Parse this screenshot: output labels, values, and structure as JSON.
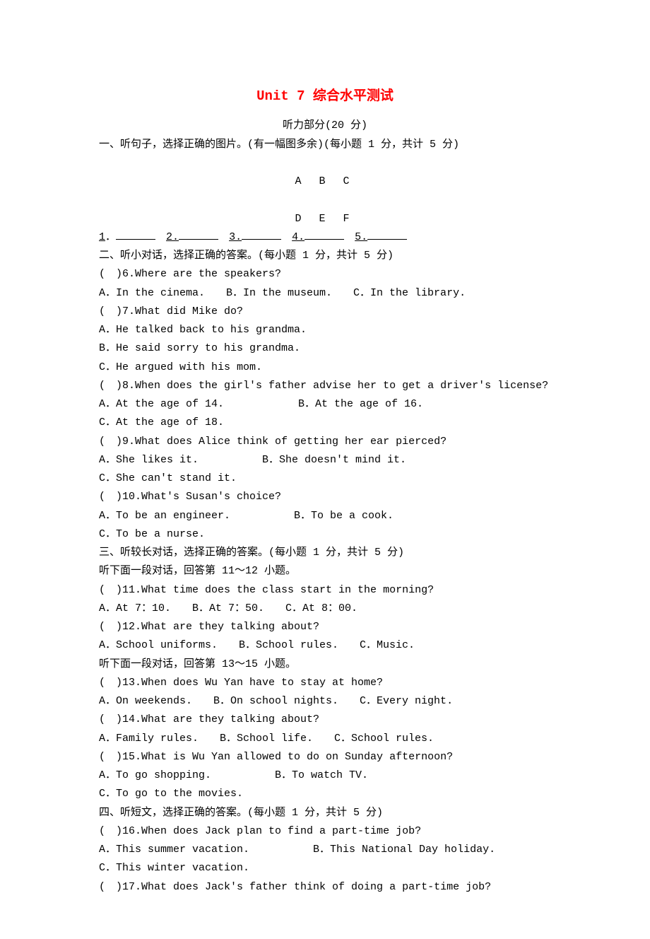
{
  "title": "Unit 7  综合水平测试",
  "subtitle": "听力部分(20 分)",
  "section1": {
    "heading": "一、听句子，选择正确的图片。(有一幅图多余)(每小题 1 分，共计 5 分)",
    "row1": "A   B   C",
    "row2": "D   E   F",
    "blanks": "1．________　2.________　3.________　4.________　5.________"
  },
  "section2": {
    "heading": "二、听小对话，选择正确的答案。(每小题 1 分，共计 5 分)",
    "q6": "(　)6.Where are the speakers?",
    "q6opts": "A．In the cinema.　　B．In the museum.　　C．In the library.",
    "q7": "(　)7.What did Mike do?",
    "q7a": "A．He talked back to his grandma.",
    "q7b": "B．He said sorry to his grandma.",
    "q7c": "C．He argued with his mom.",
    "q8": "(　)8.When does the girl's father advise her to get a driver's license?",
    "q8a": "A．At the age of 14.　　　　　　　B．At the age of 16.",
    "q8c": "C．At the age of 18.",
    "q9": "(　)9.What does Alice think of getting her ear pierced?",
    "q9a": "A．She likes it.　　　　　　B．She doesn't mind it.",
    "q9c": "C．She can't stand it.",
    "q10": "(　)10.What's Susan's choice?",
    "q10a": "A．To be an engineer.　　　　　　B．To be a cook.",
    "q10c": "C．To be a nurse."
  },
  "section3": {
    "heading": "三、听较长对话，选择正确的答案。(每小题 1 分，共计 5 分)",
    "sub1": "听下面一段对话，回答第 11～12 小题。",
    "q11": "(　)11.What time does the class start in the morning?",
    "q11opts": "A．At 7：10.　　B．At 7：50.　　C．At 8：00.",
    "q12": "(　)12.What are they talking about?",
    "q12opts": "A．School uniforms.　　B．School rules.　　C．Music.",
    "sub2": "听下面一段对话，回答第 13～15 小题。",
    "q13": "(　)13.When does Wu Yan have to stay at home?",
    "q13opts": "A．On weekends.　　B．On school nights.　　C．Every night.",
    "q14": "(　)14.What are they talking about?",
    "q14opts": "A．Family rules.　　B．School life.　　C．School rules.",
    "q15": "(　)15.What is Wu Yan allowed to do on Sunday afternoon?",
    "q15a": "A．To go shopping.　　　　　　B．To watch TV.",
    "q15c": "C．To go to the movies."
  },
  "section4": {
    "heading": "四、听短文，选择正确的答案。(每小题 1 分，共计 5 分)",
    "q16": "(　)16.When does Jack plan to find a part-time job?",
    "q16a": "A．This summer vacation.　　　　　　B．This National Day holiday.",
    "q16c": "C．This winter vacation.",
    "q17": "(　)17.What does Jack's father think of doing a part-time job?"
  }
}
